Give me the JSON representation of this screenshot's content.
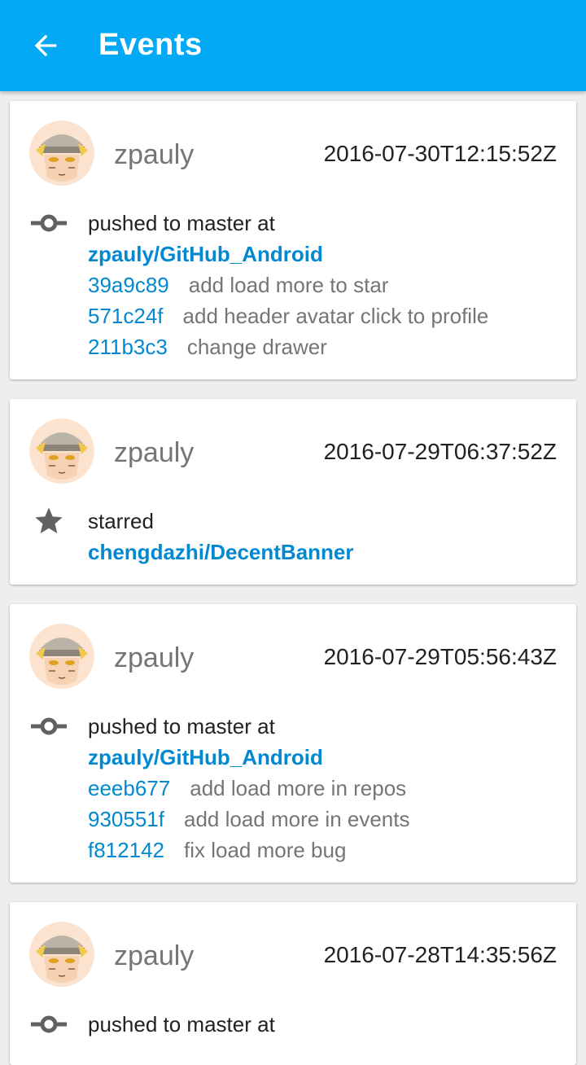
{
  "appbar": {
    "title": "Events",
    "background": "#03a9f4",
    "back_icon": "arrow-back-icon"
  },
  "colors": {
    "link": "#0288d1",
    "secondary_text": "#757575",
    "primary_text": "#212121"
  },
  "events": [
    {
      "username": "zpauly",
      "timestamp": "2016-07-30T12:15:52Z",
      "icon": "git-commit-icon",
      "action": "pushed to master at",
      "repo": "zpauly/GitHub_Android",
      "commits": [
        {
          "sha": "39a9c89",
          "message": "add load more to star"
        },
        {
          "sha": "571c24f",
          "message": "add header avatar click to profile"
        },
        {
          "sha": "211b3c3",
          "message": "change drawer"
        }
      ]
    },
    {
      "username": "zpauly",
      "timestamp": "2016-07-29T06:37:52Z",
      "icon": "star-icon",
      "action": "starred",
      "repo": "chengdazhi/DecentBanner",
      "commits": []
    },
    {
      "username": "zpauly",
      "timestamp": "2016-07-29T05:56:43Z",
      "icon": "git-commit-icon",
      "action": "pushed to master at",
      "repo": "zpauly/GitHub_Android",
      "commits": [
        {
          "sha": "eeeb677",
          "message": "add load more in repos"
        },
        {
          "sha": "930551f",
          "message": "add load more in events"
        },
        {
          "sha": "f812142",
          "message": "fix load more bug"
        }
      ]
    },
    {
      "username": "zpauly",
      "timestamp": "2016-07-28T14:35:56Z",
      "icon": "git-commit-icon",
      "action": "pushed to master at",
      "repo": "",
      "commits": []
    }
  ]
}
